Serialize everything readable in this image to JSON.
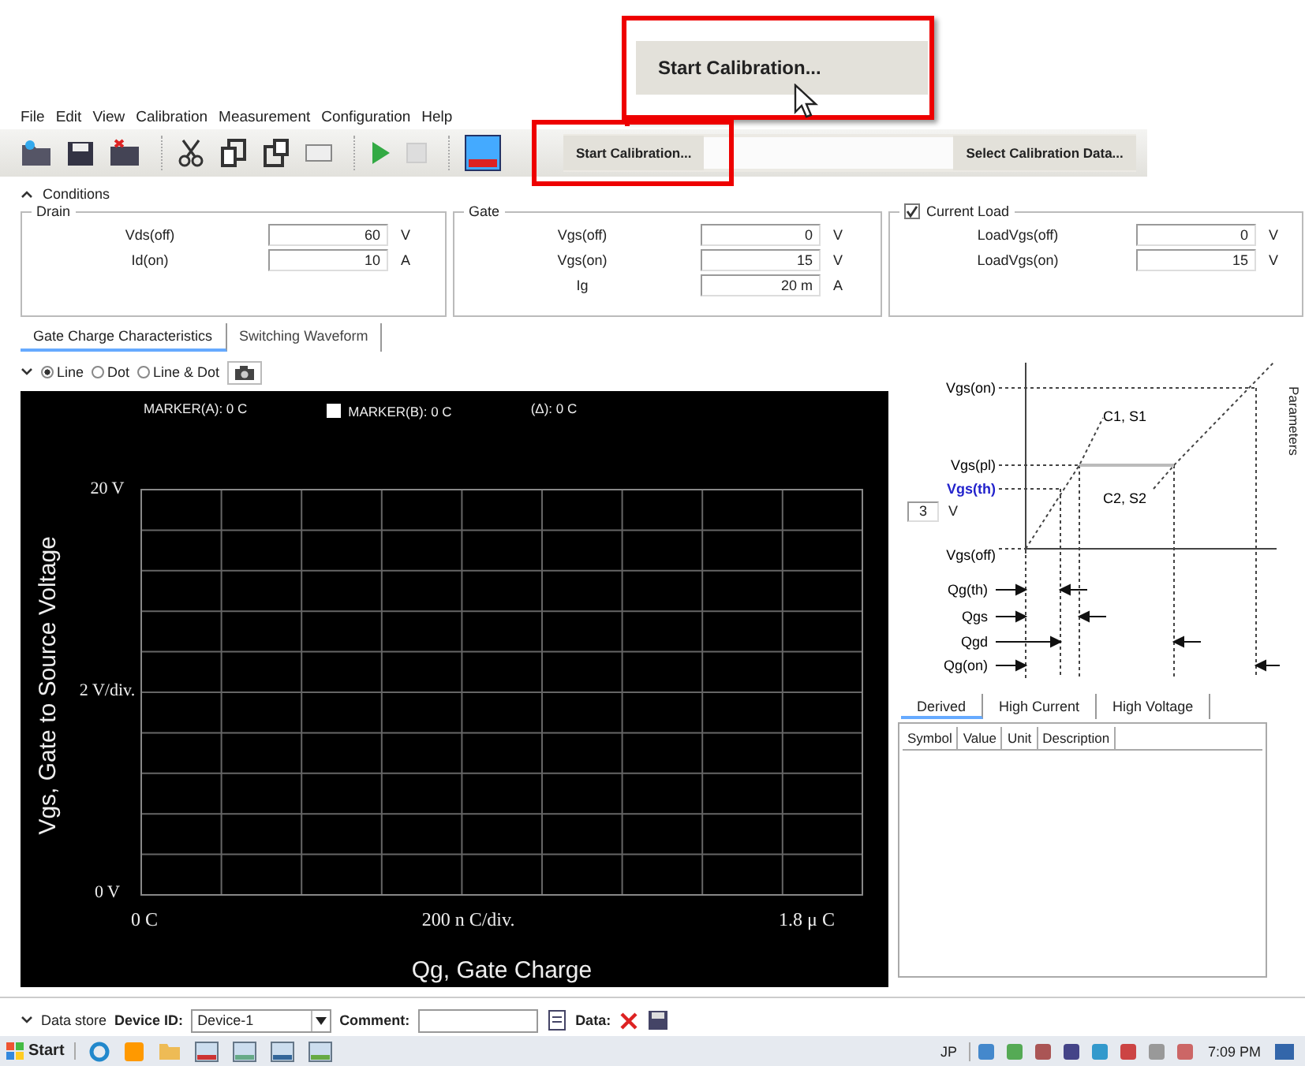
{
  "callout": {
    "button": "Start Calibration..."
  },
  "menu": [
    "File",
    "Edit",
    "View",
    "Calibration",
    "Measurement",
    "Configuration",
    "Help"
  ],
  "toolbar": {
    "start_calibration": "Start Calibration...",
    "select_calibration_data": "Select Calibration Data..."
  },
  "conditions": {
    "title": "Conditions",
    "expanded": true,
    "groups": [
      {
        "kind": "plain",
        "title": "Drain",
        "fields": [
          {
            "label": "Vds(off)",
            "value": "60",
            "unit": "V"
          },
          {
            "label": "Id(on)",
            "value": "10",
            "unit": "A"
          }
        ]
      },
      {
        "kind": "plain",
        "title": "Gate",
        "fields": [
          {
            "label": "Vgs(off)",
            "value": "0",
            "unit": "V"
          },
          {
            "label": "Vgs(on)",
            "value": "15",
            "unit": "V"
          },
          {
            "label": "Ig",
            "value": "20 m",
            "unit": "A"
          }
        ]
      },
      {
        "kind": "checkbox",
        "checked": true,
        "title": "Current Load",
        "fields": [
          {
            "label": "LoadVgs(off)",
            "value": "0",
            "unit": "V"
          },
          {
            "label": "LoadVgs(on)",
            "value": "15",
            "unit": "V"
          }
        ]
      }
    ]
  },
  "tabs": [
    {
      "label": "Gate Charge Characteristics",
      "selected": true
    },
    {
      "label": "Switching Waveform",
      "selected": false
    }
  ],
  "plot_options": [
    {
      "label": "Line",
      "selected": true
    },
    {
      "label": "Dot",
      "selected": false
    },
    {
      "label": "Line & Dot",
      "selected": false
    }
  ],
  "markers": {
    "marker_a": "MARKER(A): 0 C",
    "marker_b_checked": false,
    "marker_b": "MARKER(B): 0 C",
    "delta": "(Δ): 0 C"
  },
  "plot": {
    "y_top": "20 V",
    "y_div": "2 V/div.",
    "y_bottom": "0 V",
    "x_left": "0 C",
    "x_div": "200 n C/div.",
    "x_right": "1.8 μ C",
    "xlabel": "Qg, Gate Charge",
    "ylabel": "Vgs, Gate to Source Voltage"
  },
  "diagram": {
    "vgs_on": "Vgs(on)",
    "c1": "C1, S1",
    "vgs_pl": "Vgs(pl)",
    "vgs_th": "Vgs(th)",
    "vgs_th_value": "3",
    "vgs_th_unit": "V",
    "c2": "C2, S2",
    "vgs_off": "Vgs(off)",
    "qg_th": "Qg(th)",
    "qgs": "Qgs",
    "qgd": "Qgd",
    "qg_on": "Qg(on)"
  },
  "side_tab": "Parameters",
  "param_tabs": [
    {
      "label": "Derived",
      "selected": true
    },
    {
      "label": "High Current",
      "selected": false
    },
    {
      "label": "High Voltage",
      "selected": false
    }
  ],
  "param_table": {
    "columns": [
      "Symbol",
      "Value",
      "Unit",
      "Description"
    ]
  },
  "data_store": {
    "title": "Data store",
    "expanded": false,
    "device_label": "Device ID:",
    "device_value": "Device-1",
    "comment_label": "Comment:",
    "data_label": "Data:"
  },
  "taskbar": {
    "start": "Start",
    "language": "JP",
    "clock": "7:09 PM"
  }
}
